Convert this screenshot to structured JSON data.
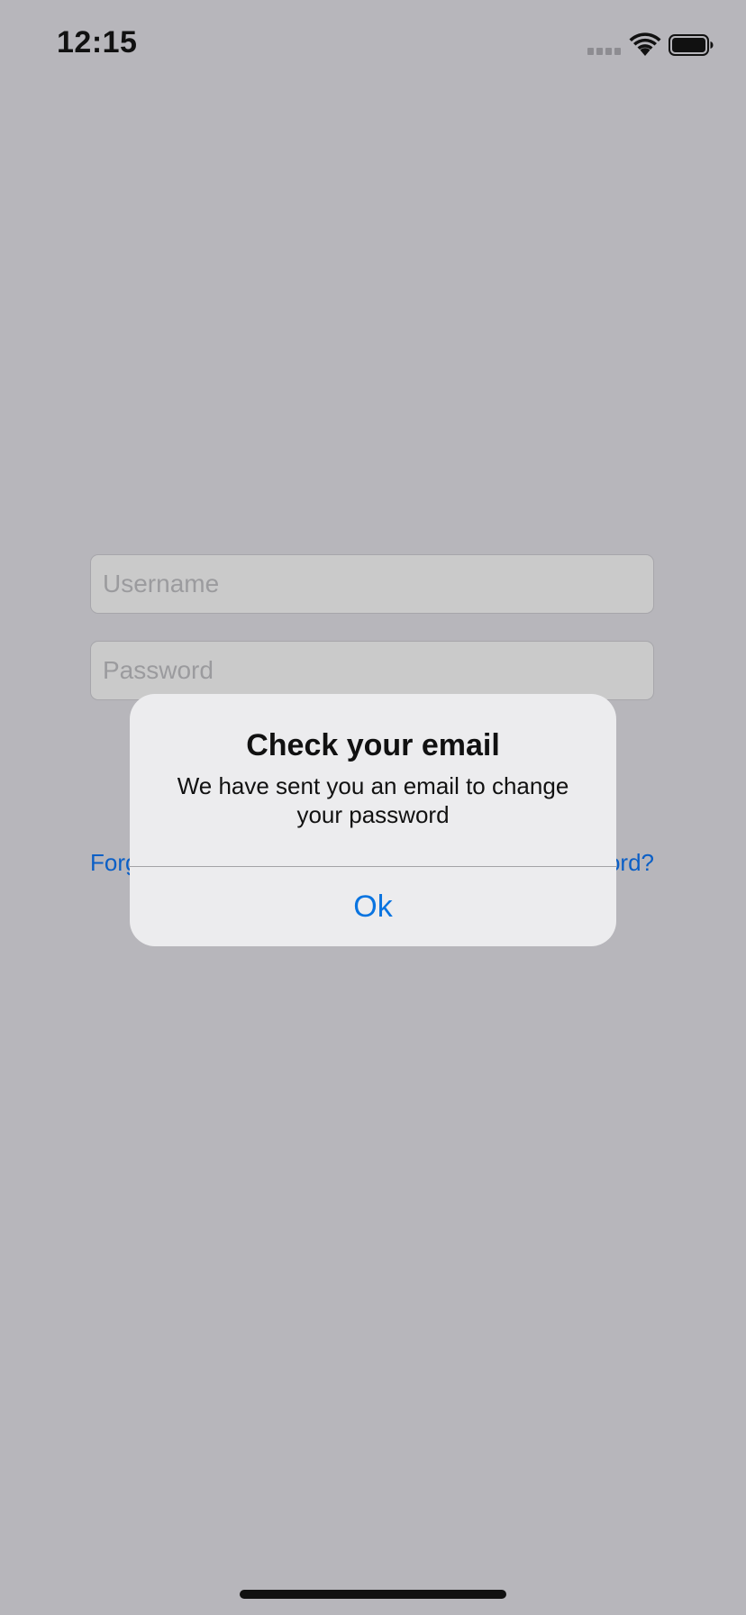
{
  "status_bar": {
    "time": "12:15"
  },
  "login_form": {
    "username_placeholder": "Username",
    "password_placeholder": "Password",
    "forgot_left_text": "Forg",
    "forgot_right_text": "ord?"
  },
  "alert": {
    "title": "Check your email",
    "message": "We have sent you an email to change your password",
    "ok_label": "Ok"
  },
  "colors": {
    "background_dim": "#b7b6bb",
    "alert_background": "#ececee",
    "accent": "#0a74e0",
    "link": "#0b5fc6"
  },
  "icons": {
    "signal": "cellular-signal-icon",
    "wifi": "wifi-icon",
    "battery": "battery-icon"
  }
}
